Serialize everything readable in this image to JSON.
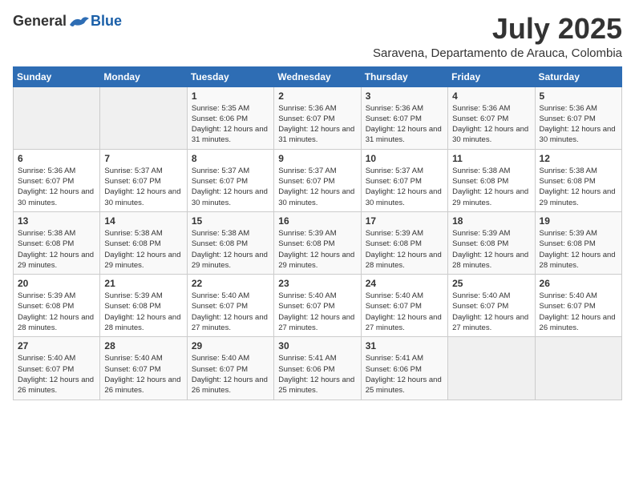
{
  "logo": {
    "general": "General",
    "blue": "Blue"
  },
  "title": {
    "month": "July 2025",
    "location": "Saravena, Departamento de Arauca, Colombia"
  },
  "weekdays": [
    "Sunday",
    "Monday",
    "Tuesday",
    "Wednesday",
    "Thursday",
    "Friday",
    "Saturday"
  ],
  "weeks": [
    [
      {
        "day": "",
        "info": ""
      },
      {
        "day": "",
        "info": ""
      },
      {
        "day": "1",
        "info": "Sunrise: 5:35 AM\nSunset: 6:06 PM\nDaylight: 12 hours and 31 minutes."
      },
      {
        "day": "2",
        "info": "Sunrise: 5:36 AM\nSunset: 6:07 PM\nDaylight: 12 hours and 31 minutes."
      },
      {
        "day": "3",
        "info": "Sunrise: 5:36 AM\nSunset: 6:07 PM\nDaylight: 12 hours and 31 minutes."
      },
      {
        "day": "4",
        "info": "Sunrise: 5:36 AM\nSunset: 6:07 PM\nDaylight: 12 hours and 30 minutes."
      },
      {
        "day": "5",
        "info": "Sunrise: 5:36 AM\nSunset: 6:07 PM\nDaylight: 12 hours and 30 minutes."
      }
    ],
    [
      {
        "day": "6",
        "info": "Sunrise: 5:36 AM\nSunset: 6:07 PM\nDaylight: 12 hours and 30 minutes."
      },
      {
        "day": "7",
        "info": "Sunrise: 5:37 AM\nSunset: 6:07 PM\nDaylight: 12 hours and 30 minutes."
      },
      {
        "day": "8",
        "info": "Sunrise: 5:37 AM\nSunset: 6:07 PM\nDaylight: 12 hours and 30 minutes."
      },
      {
        "day": "9",
        "info": "Sunrise: 5:37 AM\nSunset: 6:07 PM\nDaylight: 12 hours and 30 minutes."
      },
      {
        "day": "10",
        "info": "Sunrise: 5:37 AM\nSunset: 6:07 PM\nDaylight: 12 hours and 30 minutes."
      },
      {
        "day": "11",
        "info": "Sunrise: 5:38 AM\nSunset: 6:08 PM\nDaylight: 12 hours and 29 minutes."
      },
      {
        "day": "12",
        "info": "Sunrise: 5:38 AM\nSunset: 6:08 PM\nDaylight: 12 hours and 29 minutes."
      }
    ],
    [
      {
        "day": "13",
        "info": "Sunrise: 5:38 AM\nSunset: 6:08 PM\nDaylight: 12 hours and 29 minutes."
      },
      {
        "day": "14",
        "info": "Sunrise: 5:38 AM\nSunset: 6:08 PM\nDaylight: 12 hours and 29 minutes."
      },
      {
        "day": "15",
        "info": "Sunrise: 5:38 AM\nSunset: 6:08 PM\nDaylight: 12 hours and 29 minutes."
      },
      {
        "day": "16",
        "info": "Sunrise: 5:39 AM\nSunset: 6:08 PM\nDaylight: 12 hours and 29 minutes."
      },
      {
        "day": "17",
        "info": "Sunrise: 5:39 AM\nSunset: 6:08 PM\nDaylight: 12 hours and 28 minutes."
      },
      {
        "day": "18",
        "info": "Sunrise: 5:39 AM\nSunset: 6:08 PM\nDaylight: 12 hours and 28 minutes."
      },
      {
        "day": "19",
        "info": "Sunrise: 5:39 AM\nSunset: 6:08 PM\nDaylight: 12 hours and 28 minutes."
      }
    ],
    [
      {
        "day": "20",
        "info": "Sunrise: 5:39 AM\nSunset: 6:08 PM\nDaylight: 12 hours and 28 minutes."
      },
      {
        "day": "21",
        "info": "Sunrise: 5:39 AM\nSunset: 6:08 PM\nDaylight: 12 hours and 28 minutes."
      },
      {
        "day": "22",
        "info": "Sunrise: 5:40 AM\nSunset: 6:07 PM\nDaylight: 12 hours and 27 minutes."
      },
      {
        "day": "23",
        "info": "Sunrise: 5:40 AM\nSunset: 6:07 PM\nDaylight: 12 hours and 27 minutes."
      },
      {
        "day": "24",
        "info": "Sunrise: 5:40 AM\nSunset: 6:07 PM\nDaylight: 12 hours and 27 minutes."
      },
      {
        "day": "25",
        "info": "Sunrise: 5:40 AM\nSunset: 6:07 PM\nDaylight: 12 hours and 27 minutes."
      },
      {
        "day": "26",
        "info": "Sunrise: 5:40 AM\nSunset: 6:07 PM\nDaylight: 12 hours and 26 minutes."
      }
    ],
    [
      {
        "day": "27",
        "info": "Sunrise: 5:40 AM\nSunset: 6:07 PM\nDaylight: 12 hours and 26 minutes."
      },
      {
        "day": "28",
        "info": "Sunrise: 5:40 AM\nSunset: 6:07 PM\nDaylight: 12 hours and 26 minutes."
      },
      {
        "day": "29",
        "info": "Sunrise: 5:40 AM\nSunset: 6:07 PM\nDaylight: 12 hours and 26 minutes."
      },
      {
        "day": "30",
        "info": "Sunrise: 5:41 AM\nSunset: 6:06 PM\nDaylight: 12 hours and 25 minutes."
      },
      {
        "day": "31",
        "info": "Sunrise: 5:41 AM\nSunset: 6:06 PM\nDaylight: 12 hours and 25 minutes."
      },
      {
        "day": "",
        "info": ""
      },
      {
        "day": "",
        "info": ""
      }
    ]
  ]
}
